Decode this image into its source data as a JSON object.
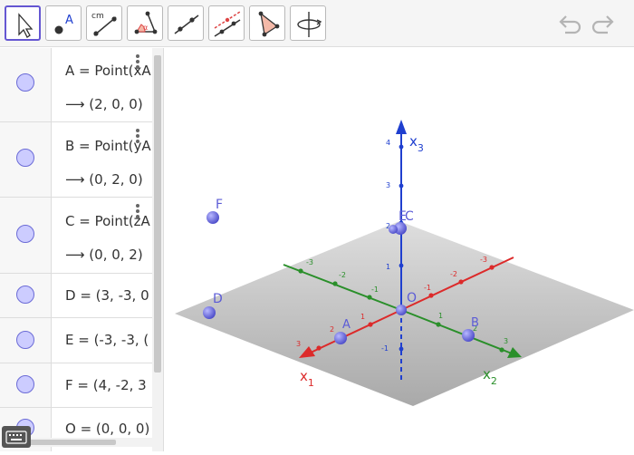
{
  "toolbar": {
    "tools": [
      {
        "name": "move-tool",
        "icon": "cursor-arrow-icon",
        "active": true
      },
      {
        "name": "point-tool",
        "icon": "point-icon",
        "label": "A"
      },
      {
        "name": "distance-tool",
        "icon": "ruler-segment-icon",
        "label": "cm"
      },
      {
        "name": "angle-tool",
        "icon": "angle-icon",
        "label": "α"
      },
      {
        "name": "line-tool",
        "icon": "line-through-points-icon"
      },
      {
        "name": "perpendicular-tool",
        "icon": "perpendicular-line-icon"
      },
      {
        "name": "polygon-tool",
        "icon": "triangle-polygon-icon"
      },
      {
        "name": "rotate-view-tool",
        "icon": "rotate-3d-view-icon"
      }
    ],
    "undo_icon": "undo-icon",
    "redo_icon": "redo-icon"
  },
  "algebra": {
    "rows": [
      {
        "def": "A = Point(xA",
        "value": "(2, 0, 0)"
      },
      {
        "def": "B = Point(yA",
        "value": "(0, 2, 0)"
      },
      {
        "def": "C = Point(zA",
        "value": "(0, 0, 2)"
      },
      {
        "def": "D = (3, -3, 0"
      },
      {
        "def": "E = (-3, -3, ("
      },
      {
        "def": "F = (4, -2, 3"
      },
      {
        "def": "O = (0, 0, 0)"
      }
    ],
    "arrow": "⟶",
    "keyboard_icon": "keyboard-icon"
  },
  "graphics": {
    "axes": {
      "x1": {
        "label": "x",
        "sub": "1",
        "color": "#dc2a2a"
      },
      "x2": {
        "label": "x",
        "sub": "2",
        "color": "#2a8f2a"
      },
      "x3": {
        "label": "x",
        "sub": "3",
        "color": "#1f3fcf"
      }
    },
    "tick_labels": {
      "x1": [
        "3",
        "2",
        "1",
        "-1",
        "-2",
        "-3"
      ],
      "x2": [
        "-3",
        "-2",
        "-1",
        "1",
        "2",
        "3"
      ],
      "x3": [
        "4",
        "3",
        "2",
        "1",
        "-1"
      ]
    },
    "points": {
      "A": "A",
      "B": "B",
      "C": "C",
      "D": "D",
      "E": "E",
      "F": "F",
      "O": "O"
    },
    "point_color": "#5c5cd6",
    "plane_color": "#8c8c8c"
  }
}
